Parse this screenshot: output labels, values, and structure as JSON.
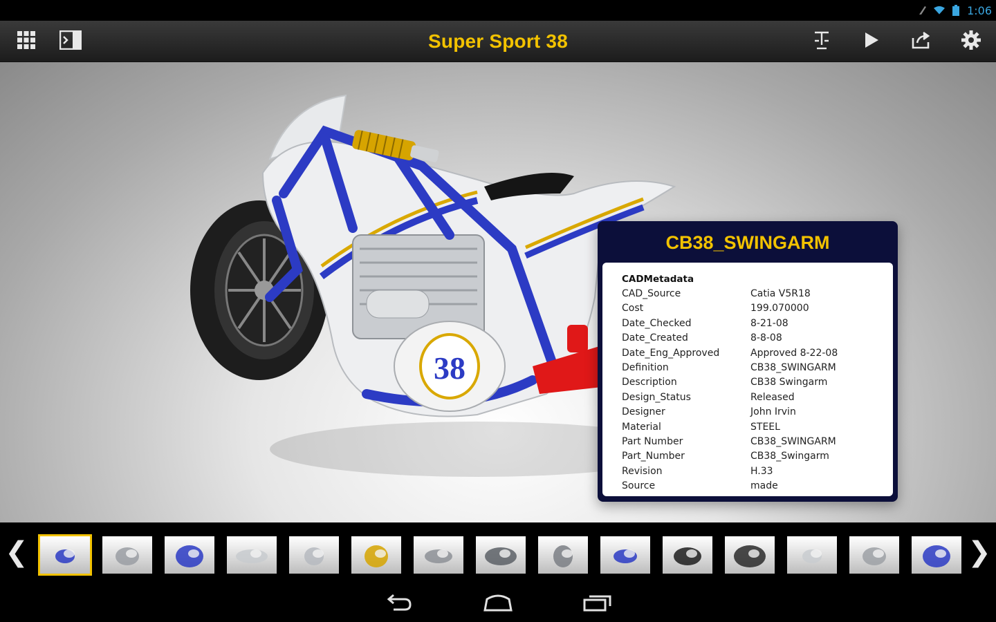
{
  "status_bar": {
    "time": "1:06"
  },
  "toolbar": {
    "title": "Super Sport 38"
  },
  "model": {
    "race_number": "38"
  },
  "info_panel": {
    "title": "CB38_SWINGARM",
    "heading": "CADMetadata",
    "rows": [
      {
        "key": "CAD_Source",
        "value": "Catia V5R18"
      },
      {
        "key": "Cost",
        "value": "199.070000"
      },
      {
        "key": "Date_Checked",
        "value": "8-21-08"
      },
      {
        "key": "Date_Created",
        "value": "8-8-08"
      },
      {
        "key": "Date_Eng_Approved",
        "value": "Approved 8-22-08"
      },
      {
        "key": "Definition",
        "value": "CB38_SWINGARM"
      },
      {
        "key": "Description",
        "value": "CB38 Swingarm"
      },
      {
        "key": "Design_Status",
        "value": "Released"
      },
      {
        "key": "Designer",
        "value": "John Irvin"
      },
      {
        "key": "Material",
        "value": "STEEL"
      },
      {
        "key": "Part Number",
        "value": "CB38_SWINGARM"
      },
      {
        "key": "Part_Number",
        "value": "CB38_Swingarm"
      },
      {
        "key": "Revision",
        "value": "H.33"
      },
      {
        "key": "Source",
        "value": "made"
      }
    ]
  },
  "colors": {
    "accent": "#f2c200",
    "frame_blue": "#2c3bc4",
    "panel_bg": "#0c0f3a",
    "swingarm_red": "#e01818"
  }
}
